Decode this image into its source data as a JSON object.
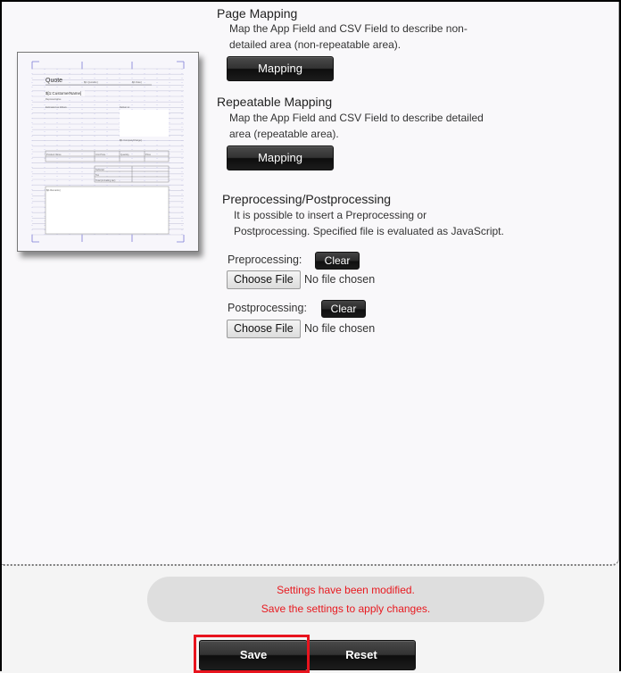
{
  "preview": {
    "title": "Quote",
    "customer_field": "$[1:CustomerName]"
  },
  "page_mapping": {
    "title": "Page Mapping",
    "description_line1": "Map the App Field and CSV Field to describe non-",
    "description_line2": "detailed area (non-repeatable area).",
    "button_label": "Mapping"
  },
  "repeatable_mapping": {
    "title": "Repeatable Mapping",
    "description_line1": "Map the App Field and CSV Field to describe detailed",
    "description_line2": "area (repeatable area).",
    "button_label": "Mapping"
  },
  "processing": {
    "title": "Preprocessing/Postprocessing",
    "description_line1": "It is possible to insert a Preprocessing or",
    "description_line2": "Postprocessing. Specified file is evaluated as JavaScript.",
    "preprocessing": {
      "label": "Preprocessing:",
      "clear_label": "Clear",
      "choose_label": "Choose File",
      "file_status": "No file chosen"
    },
    "postprocessing": {
      "label": "Postprocessing:",
      "clear_label": "Clear",
      "choose_label": "Choose File",
      "file_status": "No file chosen"
    }
  },
  "notice": {
    "line1": "Settings have been modified.",
    "line2": "Save the settings to apply changes.",
    "color": "#e8191f"
  },
  "footer": {
    "save_label": "Save",
    "reset_label": "Reset",
    "highlight_color": "#e8141e"
  }
}
